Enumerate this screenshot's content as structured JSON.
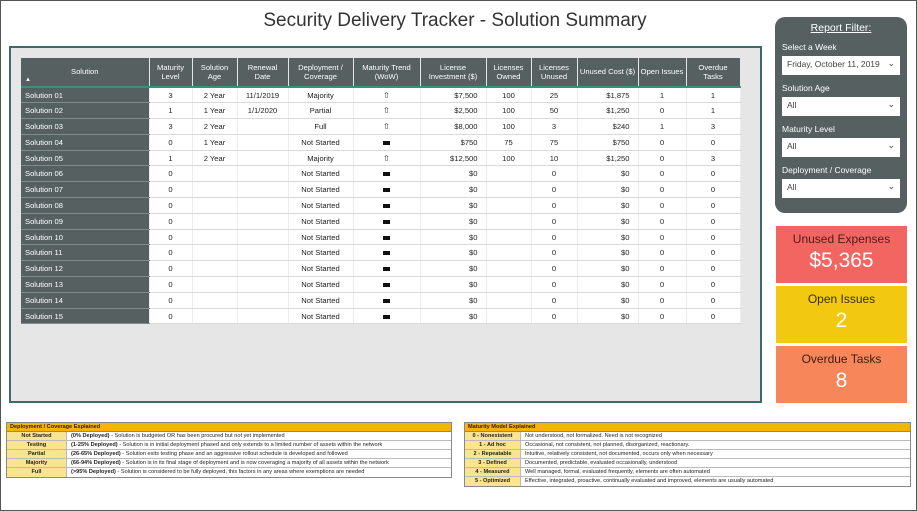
{
  "title": "Security Delivery Tracker - Solution Summary",
  "table": {
    "headers": [
      "Solution",
      "Maturity Level",
      "Solution Age",
      "Renewal Date",
      "Deployment / Coverage",
      "Maturity Trend (WoW)",
      "License Investment ($)",
      "Licenses Owned",
      "Licenses Unused",
      "Unused Cost ($)",
      "Open Issues",
      "Overdue Tasks"
    ],
    "rows": [
      [
        "Solution 01",
        "3",
        "2 Year",
        "11/1/2019",
        "Majority",
        "up",
        "$7,500",
        "100",
        "25",
        "$1,875",
        "1",
        "1"
      ],
      [
        "Solution 02",
        "1",
        "1 Year",
        "1/1/2020",
        "Partial",
        "up",
        "$2,500",
        "100",
        "50",
        "$1,250",
        "0",
        "1"
      ],
      [
        "Solution 03",
        "3",
        "2 Year",
        "",
        "Full",
        "up",
        "$8,000",
        "100",
        "3",
        "$240",
        "1",
        "3"
      ],
      [
        "Solution 04",
        "0",
        "1 Year",
        "",
        "Not Started",
        "flat",
        "$750",
        "75",
        "75",
        "$750",
        "0",
        "0"
      ],
      [
        "Solution 05",
        "1",
        "2 Year",
        "",
        "Majority",
        "up",
        "$12,500",
        "100",
        "10",
        "$1,250",
        "0",
        "3"
      ],
      [
        "Solution 06",
        "0",
        "",
        "",
        "Not Started",
        "flat",
        "$0",
        "",
        "0",
        "$0",
        "0",
        "0"
      ],
      [
        "Solution 07",
        "0",
        "",
        "",
        "Not Started",
        "flat",
        "$0",
        "",
        "0",
        "$0",
        "0",
        "0"
      ],
      [
        "Solution 08",
        "0",
        "",
        "",
        "Not Started",
        "flat",
        "$0",
        "",
        "0",
        "$0",
        "0",
        "0"
      ],
      [
        "Solution 09",
        "0",
        "",
        "",
        "Not Started",
        "flat",
        "$0",
        "",
        "0",
        "$0",
        "0",
        "0"
      ],
      [
        "Solution 10",
        "0",
        "",
        "",
        "Not Started",
        "flat",
        "$0",
        "",
        "0",
        "$0",
        "0",
        "0"
      ],
      [
        "Solution 11",
        "0",
        "",
        "",
        "Not Started",
        "flat",
        "$0",
        "",
        "0",
        "$0",
        "0",
        "0"
      ],
      [
        "Solution 12",
        "0",
        "",
        "",
        "Not Started",
        "flat",
        "$0",
        "",
        "0",
        "$0",
        "0",
        "0"
      ],
      [
        "Solution 13",
        "0",
        "",
        "",
        "Not Started",
        "flat",
        "$0",
        "",
        "0",
        "$0",
        "0",
        "0"
      ],
      [
        "Solution 14",
        "0",
        "",
        "",
        "Not Started",
        "flat",
        "$0",
        "",
        "0",
        "$0",
        "0",
        "0"
      ],
      [
        "Solution 15",
        "0",
        "",
        "",
        "Not Started",
        "flat",
        "$0",
        "",
        "0",
        "$0",
        "0",
        "0"
      ]
    ],
    "trend_icons": {
      "up": "⇧",
      "flat": "flat-bar-icon"
    }
  },
  "filter": {
    "title": "Report Filter:",
    "week_label": "Select a Week",
    "week_value": "Friday, October 11, 2019",
    "age_label": "Solution Age",
    "age_value": "All",
    "maturity_label": "Maturity Level",
    "maturity_value": "All",
    "deployment_label": "Deployment / Coverage",
    "deployment_value": "All"
  },
  "kpis": {
    "unused_label": "Unused Expenses",
    "unused_value": "$5,365",
    "open_label": "Open Issues",
    "open_value": "2",
    "overdue_label": "Overdue Tasks",
    "overdue_value": "8"
  },
  "deployment_legend": {
    "title": "Deployment / Coverage Explained",
    "rows": [
      {
        "key": "Not Started",
        "bold": "(0% Deployed)",
        "text": " - Solution is budgeted OR has been procured but not yet implemented"
      },
      {
        "key": "Testing",
        "bold": "(1-25% Deployed)",
        "text": " - Solution is in initial deployment phased and only extends to a limited number of assets within the network"
      },
      {
        "key": "Partial",
        "bold": "(26-65% Deployed)",
        "text": " - Solution exits testing phase and an aggressive rollout schedule is developed and followed"
      },
      {
        "key": "Majority",
        "bold": "(66-94% Deployed)",
        "text": " - Solution is in its final stage of deployment and is now coveraging a majority of all assets within the network"
      },
      {
        "key": "Full",
        "bold": "(>95% Deployed)",
        "text": " - Solution is considered to be fully deployed, this factors in any areas where exemptions are needed"
      }
    ]
  },
  "maturity_legend": {
    "title": "Maturity Model Explained",
    "rows": [
      {
        "key": "0 - Nonexistent",
        "text": "Not understood, not formalized. Need is not recognized"
      },
      {
        "key": "1 - Ad hoc",
        "text": "Occasional, not consistent, not planned, disorganized, reactionary."
      },
      {
        "key": "2 - Repeatable",
        "text": "Intuitive, relatively consistent, not documented, occurs only when necessary"
      },
      {
        "key": "3 - Defined",
        "text": "Documented, predictable, evaluated occasionally, understood"
      },
      {
        "key": "4 - Measured",
        "text": "Well managed, formal, evaluated frequently, elements are often automated"
      },
      {
        "key": "5 - Optimized",
        "text": "Effective, integrated, proactive, continually evaluated and improved, elements are usually automated"
      }
    ]
  },
  "colors": {
    "header_bg": "#566060",
    "unused_bg": "#f26561",
    "open_bg": "#f2c811",
    "overdue_bg": "#f7875a",
    "legend_head": "#f5b400"
  }
}
